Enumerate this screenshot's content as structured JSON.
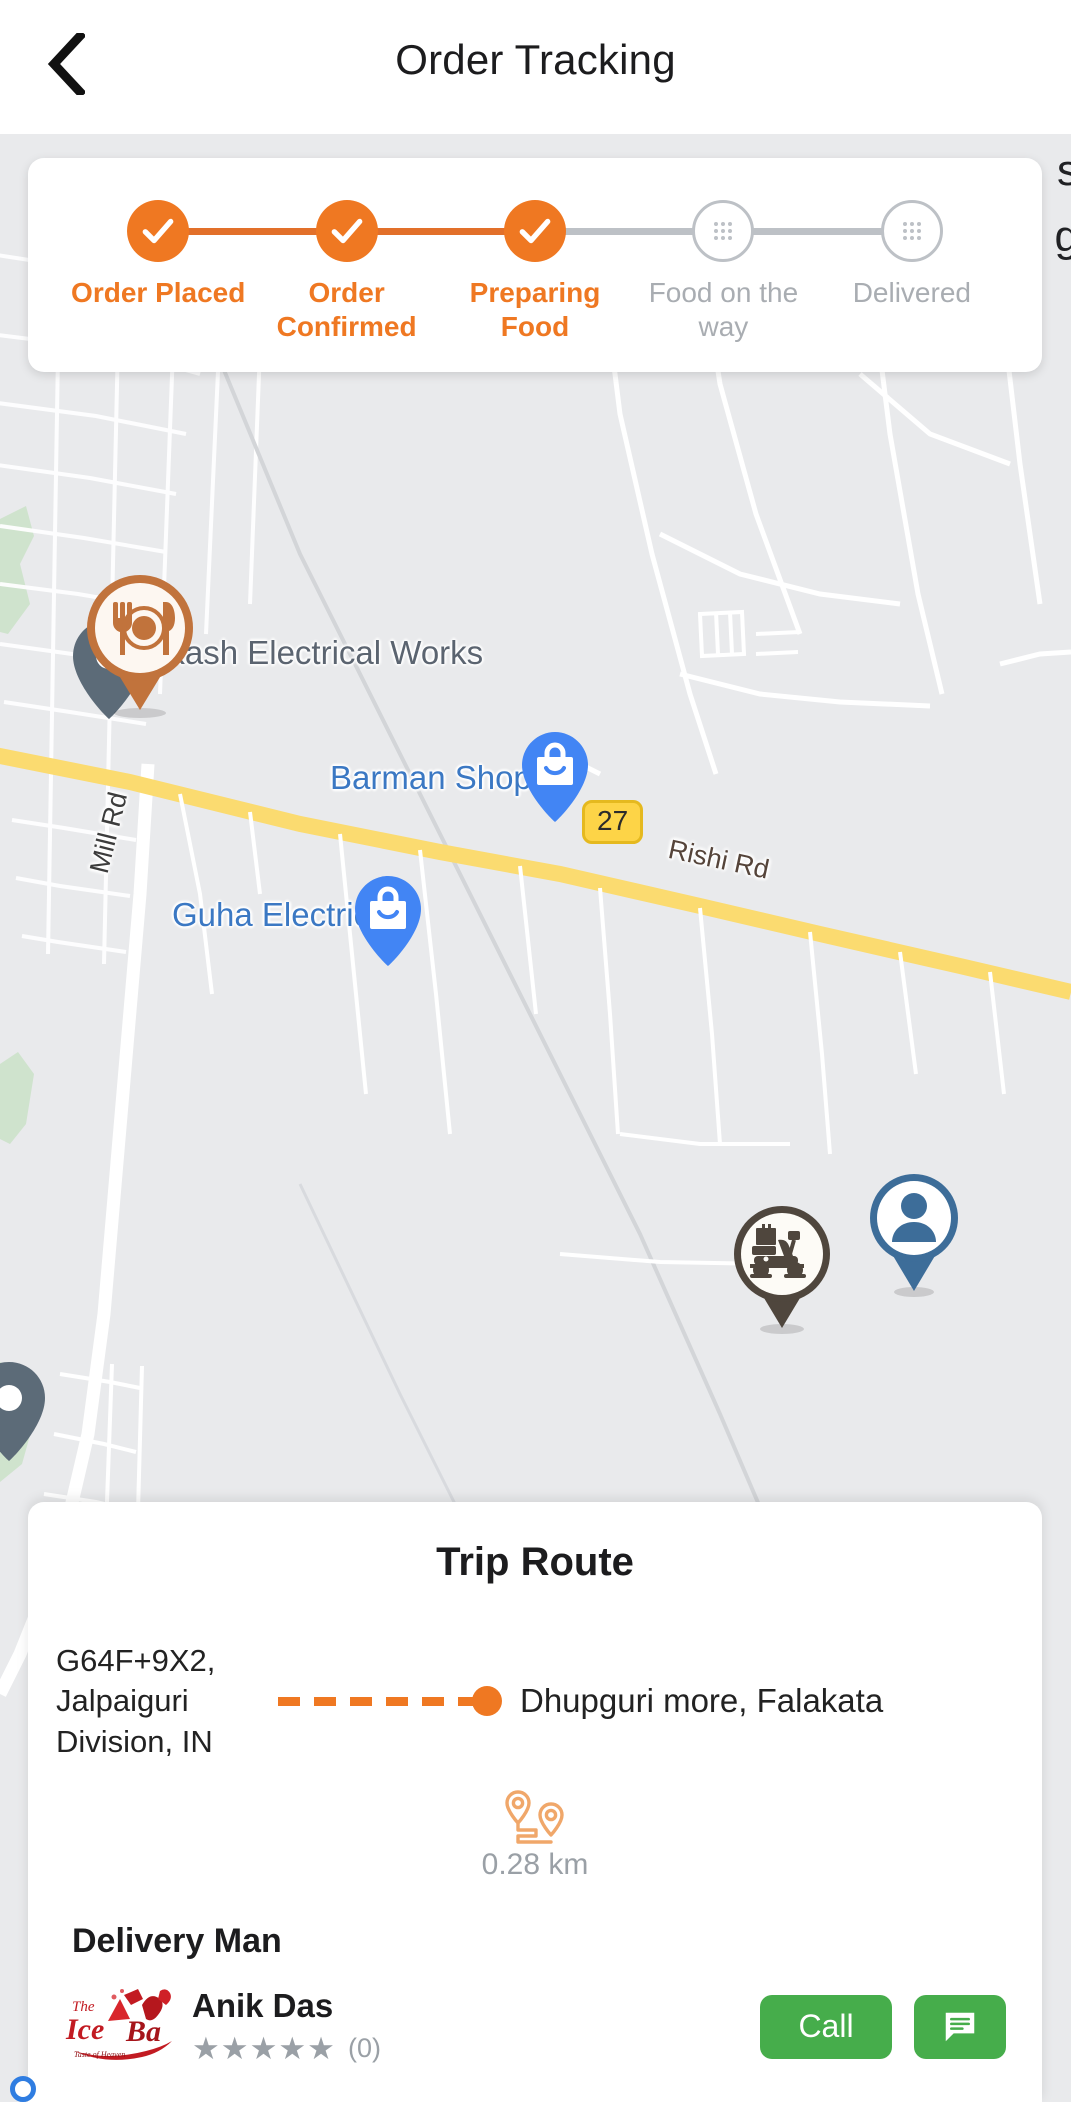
{
  "header": {
    "title": "Order Tracking",
    "back_icon": "chevron-left-icon"
  },
  "status_tracker": {
    "steps": [
      {
        "label": "Order Placed",
        "state": "done",
        "icon": "check-icon"
      },
      {
        "label": "Order Confirmed",
        "state": "done",
        "icon": "check-icon"
      },
      {
        "label": "Preparing Food",
        "state": "done",
        "icon": "check-icon"
      },
      {
        "label": "Food on the way",
        "state": "pending",
        "icon": "dots-grid-icon"
      },
      {
        "label": "Delivered",
        "state": "pending",
        "icon": "dots-grid-icon"
      }
    ],
    "active_color": "#ef7822",
    "inactive_color": "#bdc1c6"
  },
  "map": {
    "place_labels": [
      {
        "text": "akash Electrical Works",
        "type": "place"
      },
      {
        "text": "Barman Shop",
        "type": "poi"
      },
      {
        "text": "Guha Electric",
        "type": "poi"
      }
    ],
    "road_labels": [
      {
        "text": "Mill Rd"
      },
      {
        "text": "Rishi Rd"
      }
    ],
    "highway_shield": "27",
    "clipped_labels": [
      "s",
      "g"
    ],
    "markers": [
      {
        "name": "restaurant-marker",
        "icon": "restaurant-icon",
        "color": "#c1733c"
      },
      {
        "name": "shop-marker-barman",
        "icon": "shopping-bag-icon",
        "color": "#4285f4"
      },
      {
        "name": "shop-marker-guha",
        "icon": "shopping-bag-icon",
        "color": "#4285f4"
      },
      {
        "name": "delivery-man-marker",
        "icon": "scooter-icon",
        "color": "#4f463d"
      },
      {
        "name": "customer-marker",
        "icon": "person-icon",
        "color": "#3d6d99"
      },
      {
        "name": "poi-marker-left",
        "icon": "place-pin-icon",
        "color": "#556677"
      },
      {
        "name": "poi-marker-bottom-left",
        "icon": "place-pin-icon",
        "color": "#556677"
      }
    ]
  },
  "trip_route": {
    "title": "Trip Route",
    "from": "G64F+9X2, Jalpaiguri Division, IN",
    "to": "Dhupguri more, Falakata",
    "distance": "0.28 km",
    "distance_icon": "route-pins-icon"
  },
  "delivery_man": {
    "section_title": "Delivery Man",
    "name": "Anik Das",
    "stars": "★★★★★",
    "rating_count": "(0)",
    "avatar_icon": "ice-bar-logo",
    "call_label": "Call",
    "chat_icon": "chat-icon",
    "button_color": "#46ad4b"
  }
}
